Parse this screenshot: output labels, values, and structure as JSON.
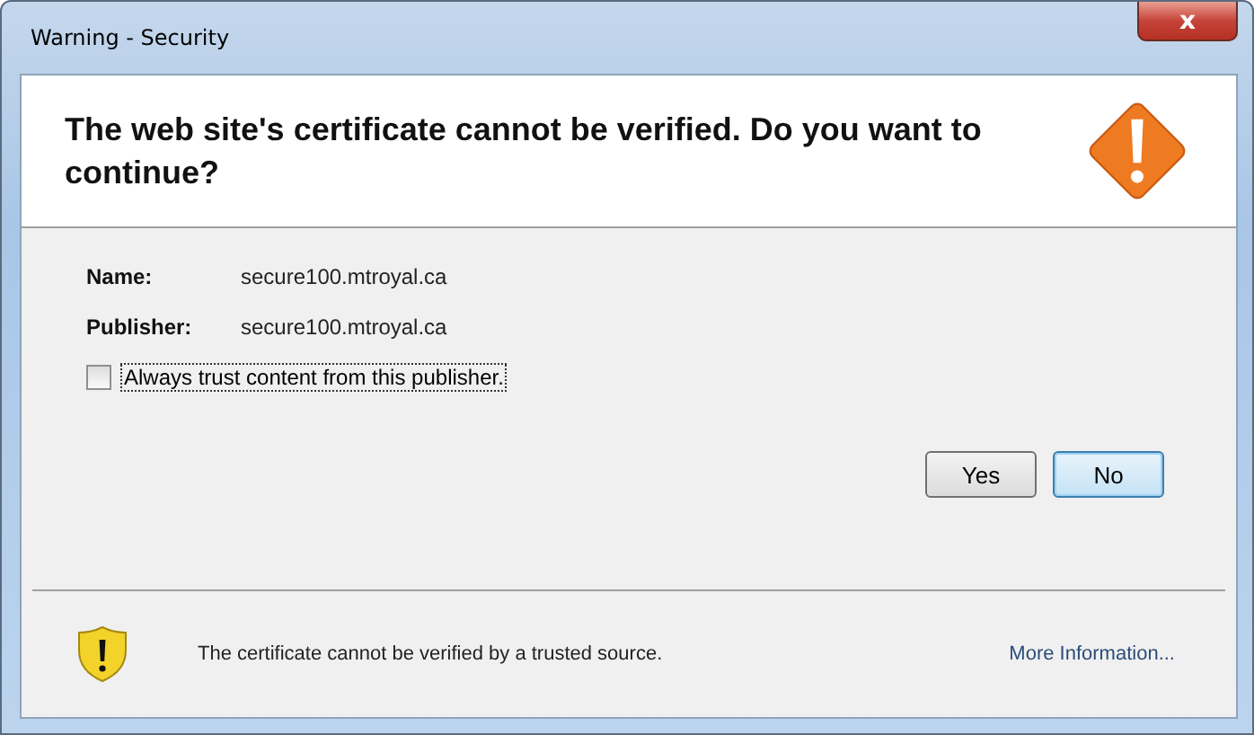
{
  "window": {
    "title": "Warning - Security",
    "close_label": "x"
  },
  "header": {
    "message": "The web site's certificate cannot be verified.  Do you want to continue?"
  },
  "details": [
    {
      "label": "Name:",
      "value": "secure100.mtroyal.ca"
    },
    {
      "label": "Publisher:",
      "value": "secure100.mtroyal.ca"
    }
  ],
  "trust_checkbox": {
    "label": "Always trust content from this publisher.",
    "checked": false
  },
  "buttons": [
    {
      "label": "Yes",
      "default": false
    },
    {
      "label": "No",
      "default": true
    }
  ],
  "footer": {
    "message": "The certificate cannot be verified by a trusted source.",
    "link": "More Information..."
  }
}
